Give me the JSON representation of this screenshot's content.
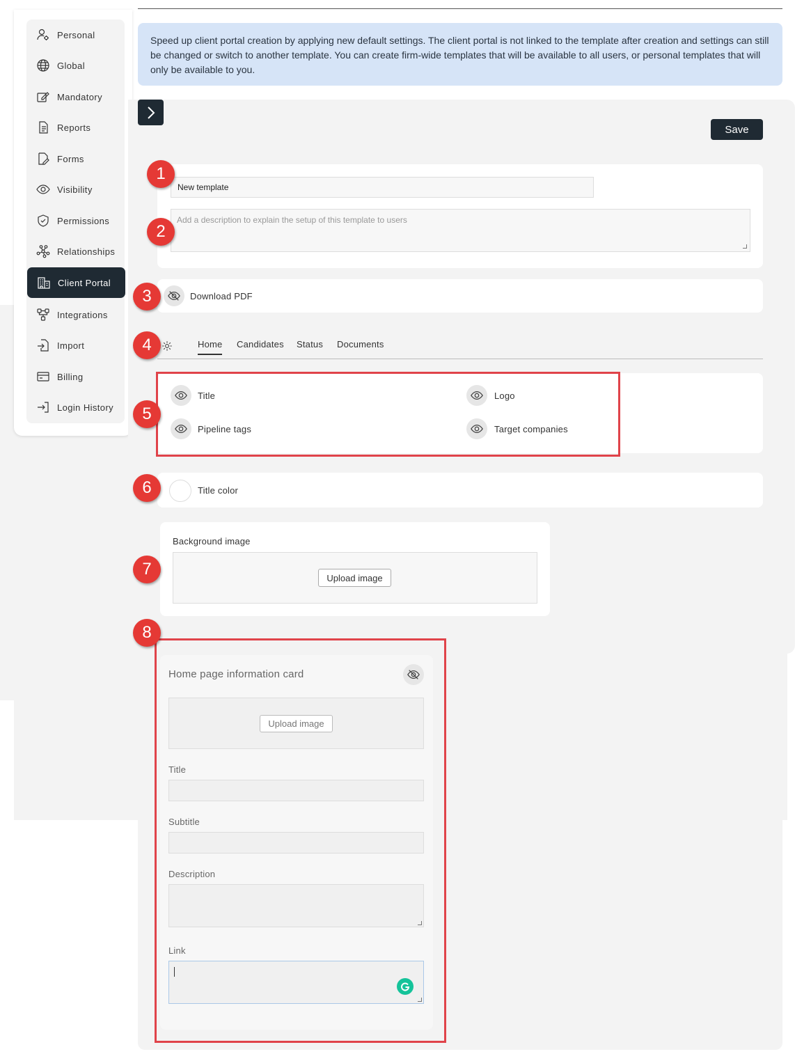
{
  "sidebar": {
    "items": [
      {
        "label": "Personal",
        "icon": "user-settings-icon"
      },
      {
        "label": "Global",
        "icon": "globe-icon"
      },
      {
        "label": "Mandatory",
        "icon": "edit-icon"
      },
      {
        "label": "Reports",
        "icon": "document-icon"
      },
      {
        "label": "Forms",
        "icon": "form-icon"
      },
      {
        "label": "Visibility",
        "icon": "eye-icon"
      },
      {
        "label": "Permissions",
        "icon": "shield-icon"
      },
      {
        "label": "Relationships",
        "icon": "network-icon"
      },
      {
        "label": "Client Portal",
        "icon": "building-icon",
        "active": true
      },
      {
        "label": "Integrations",
        "icon": "integrations-icon"
      },
      {
        "label": "Import",
        "icon": "import-icon"
      },
      {
        "label": "Billing",
        "icon": "billing-icon"
      },
      {
        "label": "Login History",
        "icon": "login-icon"
      }
    ]
  },
  "info_banner": "Speed up client portal creation by applying new default settings. The client portal is not linked to the template after creation and settings can still be changed or switch to another template. You can create firm-wide templates that will be available to all users, or personal templates that will only be available to you.",
  "toolbar": {
    "save_label": "Save"
  },
  "template": {
    "name_value": "New template",
    "description_placeholder": "Add a description to explain the setup of this template to users"
  },
  "download_pdf": {
    "label": "Download PDF",
    "visible": false
  },
  "tabs": [
    {
      "label": "Home",
      "active": true
    },
    {
      "label": "Candidates"
    },
    {
      "label": "Status"
    },
    {
      "label": "Documents"
    }
  ],
  "visibility_toggles": [
    {
      "label": "Title",
      "visible": true
    },
    {
      "label": "Logo",
      "visible": true
    },
    {
      "label": "Pipeline tags",
      "visible": true
    },
    {
      "label": "Target companies",
      "visible": true
    }
  ],
  "title_color": {
    "label": "Title color",
    "value": "#ffffff"
  },
  "background_image": {
    "label": "Background image",
    "upload_label": "Upload image"
  },
  "info_card": {
    "heading": "Home page information card",
    "upload_label": "Upload image",
    "title_label": "Title",
    "subtitle_label": "Subtitle",
    "description_label": "Description",
    "link_label": "Link"
  },
  "markers": [
    "1",
    "2",
    "3",
    "4",
    "5",
    "6",
    "7",
    "8"
  ],
  "colors": {
    "dark": "#1f2a33",
    "banner": "#d6e4f7",
    "marker": "#e53935",
    "highlight": "#e0434a"
  }
}
